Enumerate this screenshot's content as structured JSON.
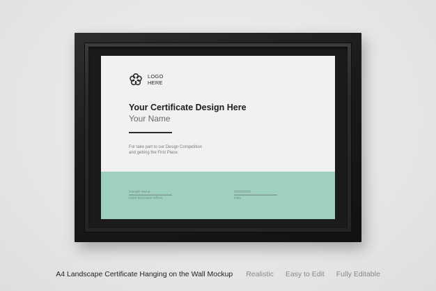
{
  "colors": {
    "wall": "#e9e9e9",
    "frame": "#1a1a1a",
    "paper": "#f1f1f1",
    "accent_band": "#9fd0bf",
    "title_text": "#1e1e1e",
    "muted_text": "#7a7a7a",
    "caption_tag": "#8a8a8a"
  },
  "certificate": {
    "logo": {
      "icon": "flower-logo-icon",
      "line1": "LOGO",
      "line2": "HERE"
    },
    "title": "Your Certificate Design Here",
    "name": "Your Name",
    "body_line1": "For take part to our Design Competition",
    "body_line2": "and getting the First Place.",
    "signature_left": {
      "name": "Sample Name",
      "role": "Chief Executive Officer"
    },
    "signature_right": {
      "value": "00/00/0000",
      "label": "Date"
    }
  },
  "caption": {
    "title": "A4 Landscape Certificate Hanging on the Wall Mockup",
    "tags": [
      "Realistic",
      "Easy to Edit",
      "Fully Editable"
    ]
  }
}
